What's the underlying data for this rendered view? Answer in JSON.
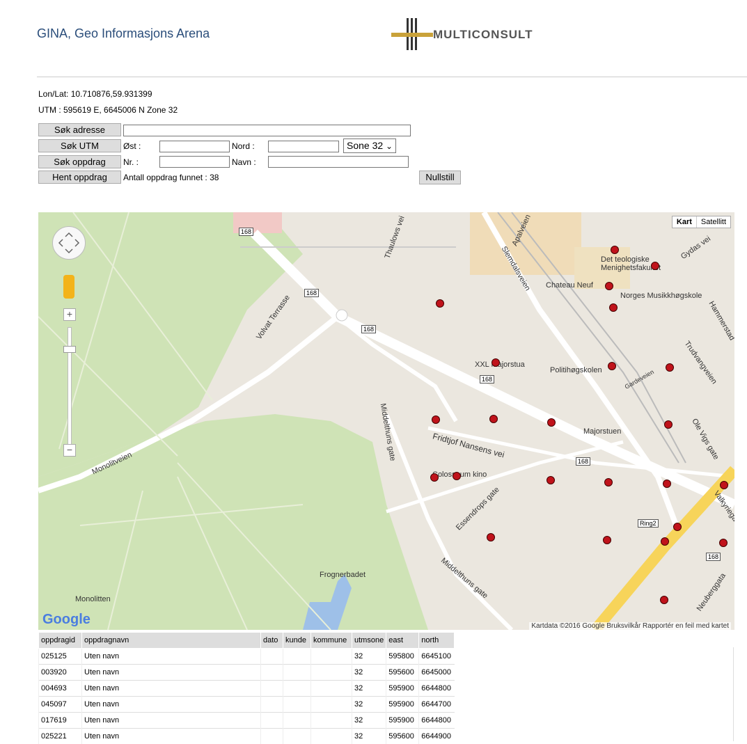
{
  "header": {
    "title": "GINA, Geo Informasjons Arena",
    "logo_text": "MULTICONSULT",
    "logo_small": "MULTICONSULT"
  },
  "coords": {
    "lonlat": "Lon/Lat: 10.710876,59.931399",
    "utm": "UTM : 595619 E, 6645006 N Zone 32"
  },
  "form": {
    "sok_adresse": "Søk adresse",
    "sok_utm": "Søk UTM",
    "sok_oppdrag": "Søk oppdrag",
    "hent_oppdrag": "Hent oppdrag",
    "ost_label": "Øst :",
    "nord_label": "Nord :",
    "nr_label": "Nr. :",
    "navn_label": "Navn :",
    "zone": "Sone 32",
    "found": "Antall oppdrag funnet : 38",
    "nullstill": "Nullstill"
  },
  "map": {
    "type_map": "Kart",
    "type_sat": "Satellitt",
    "attribution": "Kartdata ©2016 Google   Bruksvilkår   Rapportér en feil med kartet",
    "google": "Google",
    "labels": {
      "thaulows": "Thaulows vei",
      "apalveien": "Apalveien",
      "slemdalsveien": "Slemdalsveien",
      "gydas": "Gydas vei",
      "teologiske": "Det teologiske Menighetsfakultet",
      "chateau": "Chateau Neuf",
      "musikk": "Norges Musikkhøgskole",
      "hammerstad": "Hammerstad",
      "volvat": "Volvat Terrasse",
      "xxl": "XXL Majorstua",
      "politi": "Politihøgskolen",
      "gardeveien": "Gardeveien",
      "trudvang": "Trudvangveien",
      "majorstuen": "Majorstuen",
      "olevigs": "Ole Vigs gate",
      "fridtjof": "Fridtjof Nansens vei",
      "middelthuns": "Middelthuns gate",
      "middelthuns2": "Middelthuns gate",
      "monolitveien": "Monolitveien",
      "colosseum": "Colosseum kino",
      "essendrops": "Essendrops gate",
      "valkyrie": "Valkyriegata",
      "frognerbadet": "Frognerbadet",
      "monolitten": "Monolitten",
      "neuberg": "Neuberggata",
      "ring2": "Ring2",
      "r168": "168"
    }
  },
  "table": {
    "headers": [
      "oppdragid",
      "oppdragnavn",
      "dato",
      "kunde",
      "kommune",
      "utmsone",
      "east",
      "north"
    ],
    "rows": [
      [
        "025125",
        "Uten navn",
        "",
        "",
        "",
        "32",
        "595800",
        "6645100"
      ],
      [
        "003920",
        "Uten navn",
        "",
        "",
        "",
        "32",
        "595600",
        "6645000"
      ],
      [
        "004693",
        "Uten navn",
        "",
        "",
        "",
        "32",
        "595900",
        "6644800"
      ],
      [
        "045097",
        "Uten navn",
        "",
        "",
        "",
        "32",
        "595900",
        "6644700"
      ],
      [
        "017619",
        "Uten navn",
        "",
        "",
        "",
        "32",
        "595900",
        "6644800"
      ],
      [
        "025221",
        "Uten navn",
        "",
        "",
        "",
        "32",
        "595600",
        "6644900"
      ]
    ]
  }
}
